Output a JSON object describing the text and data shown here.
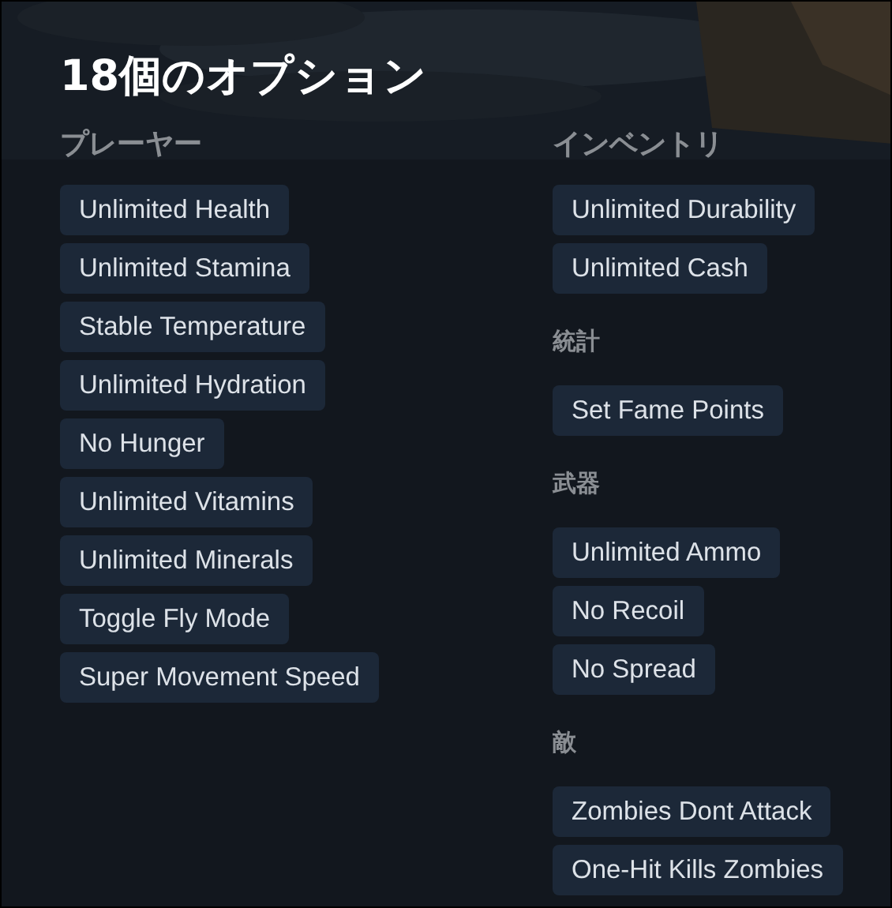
{
  "title": "18個のオプション",
  "columns": [
    {
      "sections": [
        {
          "heading": "プレーヤー",
          "options": [
            "Unlimited Health",
            "Unlimited Stamina",
            "Stable Temperature",
            "Unlimited Hydration",
            "No Hunger",
            "Unlimited Vitamins",
            "Unlimited Minerals",
            "Toggle Fly Mode",
            "Super Movement Speed"
          ]
        }
      ]
    },
    {
      "sections": [
        {
          "heading": "インベントリ",
          "options": [
            "Unlimited Durability",
            "Unlimited Cash"
          ]
        },
        {
          "heading": "統計",
          "options": [
            "Set Fame Points"
          ]
        },
        {
          "heading": "武器",
          "options": [
            "Unlimited Ammo",
            "No Recoil",
            "No Spread"
          ]
        },
        {
          "heading": "敵",
          "options": [
            "Zombies Dont Attack",
            "One-Hit Kills Zombies"
          ]
        }
      ]
    }
  ]
}
